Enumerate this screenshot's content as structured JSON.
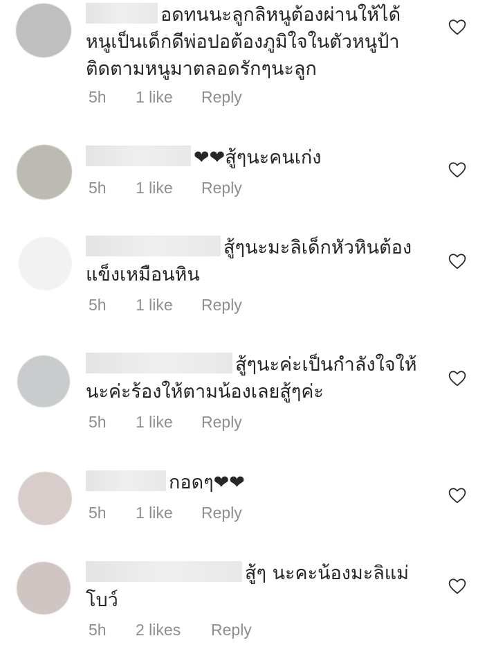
{
  "comments": [
    {
      "text": "อดทนนะลูกลิหนูต้องผ่านให้ได้ หนูเป็นเด็กดีพ่อปอต้องภูมิใจในตัวหนูป้าติดตามหนูมาตลอดรักๆนะลูก",
      "time": "5h",
      "likes": "1 like",
      "reply": "Reply",
      "avatar_color": "#bfbfbf"
    },
    {
      "text": "❤❤สู้ๆนะคนเก่ง",
      "time": "5h",
      "likes": "1 like",
      "reply": "Reply",
      "avatar_color": "#bcbab2"
    },
    {
      "text": "สู้ๆนะมะลิเด็กหัวหินต้องแข็งเหมือนหิน",
      "time": "5h",
      "likes": "1 like",
      "reply": "Reply",
      "avatar_color": "#f2f2f2"
    },
    {
      "text": "สู้ๆนะค่ะเป็นกำลังใจให้นะค่ะร้องให้ตามน้องเลยสู้ๆค่ะ",
      "time": "5h",
      "likes": "1 like",
      "reply": "Reply",
      "avatar_color": "#c9cccd"
    },
    {
      "text": "กอดๆ❤❤",
      "time": "5h",
      "likes": "1 like",
      "reply": "Reply",
      "avatar_color": "#d8cdca"
    },
    {
      "text": "สู้ๆ นะคะน้องมะลิแม่โบว์",
      "time": "5h",
      "likes": "2 likes",
      "reply": "Reply",
      "avatar_color": "#cfc6c4"
    }
  ]
}
